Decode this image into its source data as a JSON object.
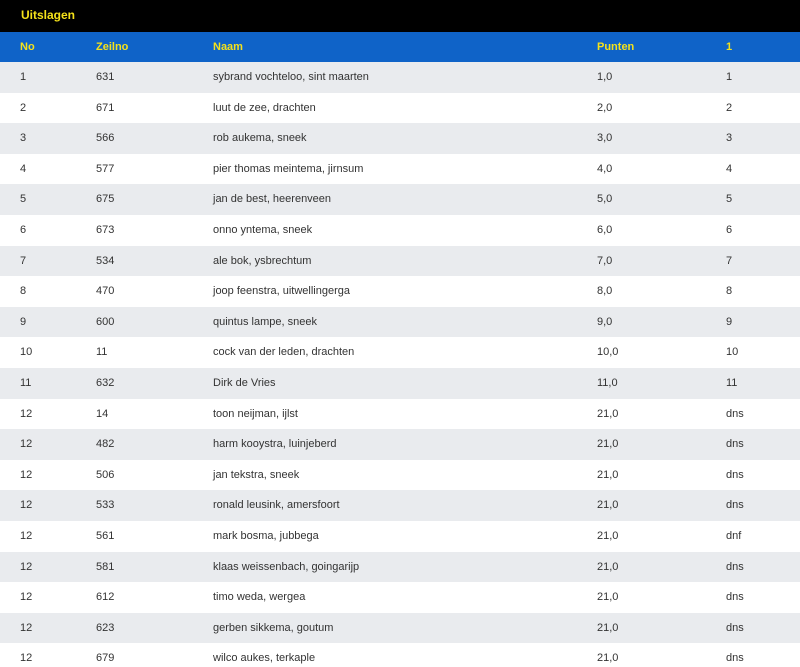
{
  "title": "Uitslagen",
  "columns": {
    "no": "No",
    "zeilno": "Zeilno",
    "naam": "Naam",
    "punten": "Punten",
    "race1": "1"
  },
  "colors": {
    "title_bar": "#000000",
    "header_bar": "#0f63c8",
    "header_text": "#f5e21a",
    "row_alt": "#e9ebee"
  },
  "rows": [
    {
      "no": "1",
      "zeilno": "631",
      "naam": "sybrand vochteloo, sint maarten",
      "punten": "1,0",
      "race1": "1"
    },
    {
      "no": "2",
      "zeilno": "671",
      "naam": "luut de zee, drachten",
      "punten": "2,0",
      "race1": "2"
    },
    {
      "no": "3",
      "zeilno": "566",
      "naam": "rob aukema, sneek",
      "punten": "3,0",
      "race1": "3"
    },
    {
      "no": "4",
      "zeilno": "577",
      "naam": "pier thomas meintema, jirnsum",
      "punten": "4,0",
      "race1": "4"
    },
    {
      "no": "5",
      "zeilno": "675",
      "naam": "jan de best, heerenveen",
      "punten": "5,0",
      "race1": "5"
    },
    {
      "no": "6",
      "zeilno": "673",
      "naam": "onno yntema, sneek",
      "punten": "6,0",
      "race1": "6"
    },
    {
      "no": "7",
      "zeilno": "534",
      "naam": "ale bok, ysbrechtum",
      "punten": "7,0",
      "race1": "7"
    },
    {
      "no": "8",
      "zeilno": "470",
      "naam": "joop feenstra, uitwellingerga",
      "punten": "8,0",
      "race1": "8"
    },
    {
      "no": "9",
      "zeilno": "600",
      "naam": "quintus lampe, sneek",
      "punten": "9,0",
      "race1": "9"
    },
    {
      "no": "10",
      "zeilno": "11",
      "naam": "cock van der leden, drachten",
      "punten": "10,0",
      "race1": "10"
    },
    {
      "no": "11",
      "zeilno": "632",
      "naam": "Dirk de Vries",
      "punten": "11,0",
      "race1": "11"
    },
    {
      "no": "12",
      "zeilno": "14",
      "naam": "toon neijman, ijlst",
      "punten": "21,0",
      "race1": "dns"
    },
    {
      "no": "12",
      "zeilno": "482",
      "naam": "harm kooystra, luinjeberd",
      "punten": "21,0",
      "race1": "dns"
    },
    {
      "no": "12",
      "zeilno": "506",
      "naam": "jan tekstra, sneek",
      "punten": "21,0",
      "race1": "dns"
    },
    {
      "no": "12",
      "zeilno": "533",
      "naam": "ronald leusink, amersfoort",
      "punten": "21,0",
      "race1": "dns"
    },
    {
      "no": "12",
      "zeilno": "561",
      "naam": "mark bosma, jubbega",
      "punten": "21,0",
      "race1": "dnf"
    },
    {
      "no": "12",
      "zeilno": "581",
      "naam": "klaas weissenbach, goingarijp",
      "punten": "21,0",
      "race1": "dns"
    },
    {
      "no": "12",
      "zeilno": "612",
      "naam": "timo weda, wergea",
      "punten": "21,0",
      "race1": "dns"
    },
    {
      "no": "12",
      "zeilno": "623",
      "naam": "gerben sikkema, goutum",
      "punten": "21,0",
      "race1": "dns"
    },
    {
      "no": "12",
      "zeilno": "679",
      "naam": "wilco aukes, terkaple",
      "punten": "21,0",
      "race1": "dns"
    }
  ]
}
